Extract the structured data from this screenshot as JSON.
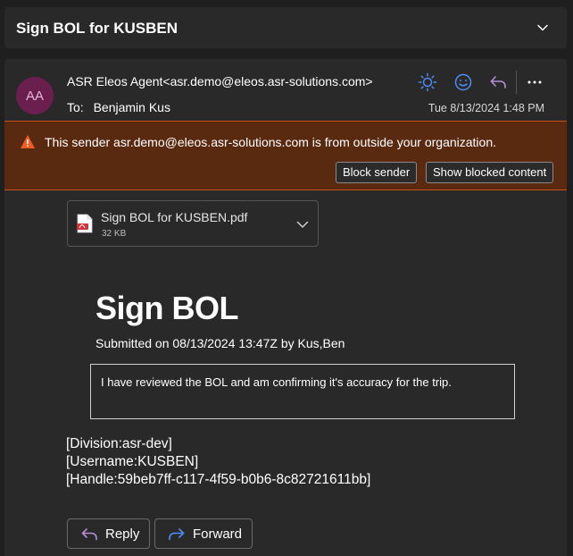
{
  "subject": {
    "title": "Sign BOL for KUSBEN"
  },
  "message": {
    "avatar_initials": "AA",
    "sender": "ASR Eleos Agent<asr.demo@eleos.asr-solutions.com>",
    "to_label": "To:",
    "to_name": "Benjamin Kus",
    "date": "Tue 8/13/2024 1:48 PM"
  },
  "warning": {
    "text": "This sender asr.demo@eleos.asr-solutions.com is from outside your organization.",
    "block_label": "Block sender",
    "show_label": "Show blocked content"
  },
  "attachment": {
    "name": "Sign BOL for KUSBEN.pdf",
    "size": "32 KB"
  },
  "body": {
    "title": "Sign BOL",
    "submitted": "Submitted on 08/13/2024 13:47Z by Kus,Ben",
    "statement": "I have reviewed the BOL and am confirming it's accuracy for the trip.",
    "division": "[Division:asr-dev]",
    "username": "[Username:KUSBEN]",
    "handle": "[Handle:59beb7ff-c117-4f59-b0b6-8c82721611bb]"
  },
  "actions": {
    "reply_label": "Reply",
    "forward_label": "Forward"
  },
  "colors": {
    "background": "#1f1f1f",
    "card": "#292929",
    "warning_bg": "#5a2a10",
    "warning_border": "#c3511b",
    "accent_blue": "#4f8cf5",
    "reply_purple": "#b38ed6"
  },
  "icons": {
    "subject_toggle": "chevron-down-icon",
    "header_actions": [
      "sun-icon",
      "emoji-icon",
      "reply-icon",
      "more-icon"
    ],
    "warning": "warning-icon",
    "attachment": "pdf-icon"
  }
}
